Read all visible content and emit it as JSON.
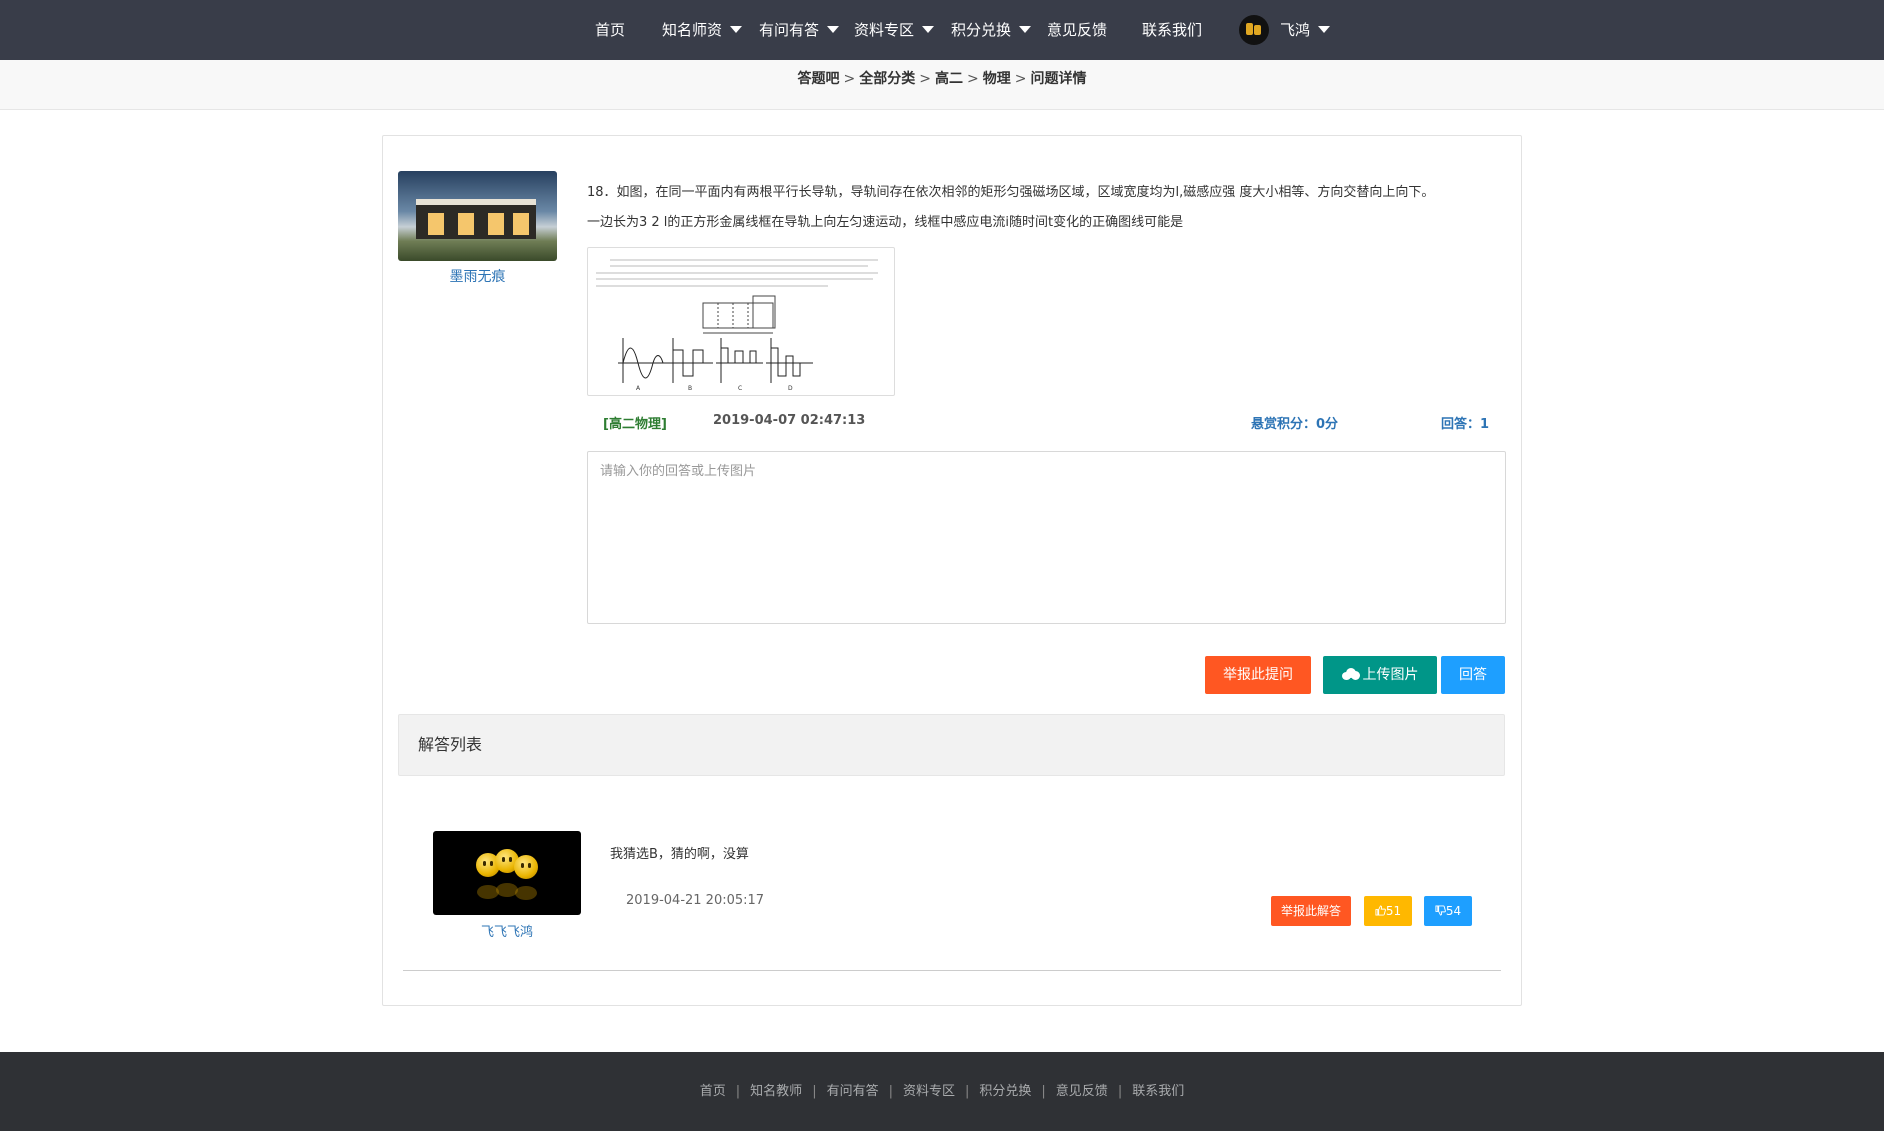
{
  "nav": {
    "items": [
      {
        "label": "首页",
        "dropdown": false
      },
      {
        "label": "知名师资",
        "dropdown": true
      },
      {
        "label": "有问有答",
        "dropdown": true
      },
      {
        "label": "资料专区",
        "dropdown": true
      },
      {
        "label": "积分兑换",
        "dropdown": true
      },
      {
        "label": "意见反馈",
        "dropdown": false
      },
      {
        "label": "联系我们",
        "dropdown": false
      }
    ],
    "user": {
      "name": "飞鸿",
      "icon": "user-avatar"
    }
  },
  "breadcrumb": {
    "items": [
      "答题吧",
      "全部分类",
      "高二",
      "物理",
      "问题详情"
    ],
    "separator": ">"
  },
  "question": {
    "asker_name": "墨雨无痕",
    "text_line1": "18．如图，在同一平面内有两根平行长导轨，导轨间存在依次相邻的矩形匀强磁场区域，区域宽度均为l,磁感应强 度大小相等、方向交替向上向下。",
    "text_line2": "一边长为3 2 l的正方形金属线框在导轨上向左匀速运动，线框中感应电流i随时间t变化的正确图线可能是",
    "category": "[高二物理]",
    "time": "2019-04-07 02:47:13",
    "reward": "悬赏积分：0分",
    "answer_count": "回答：1"
  },
  "reply": {
    "placeholder": "请输入你的回答或上传图片",
    "report_label": "举报此提问",
    "upload_label": "上传图片",
    "submit_label": "回答"
  },
  "answers": {
    "header": "解答列表",
    "items": [
      {
        "name": "飞飞飞鸿",
        "text": "我猜选B，猜的啊，没算",
        "time": "2019-04-21 20:05:17",
        "report_label": "举报此解答",
        "likes": "51",
        "dislikes": "54"
      }
    ]
  },
  "footer": {
    "links": [
      "首页",
      "知名教师",
      "有问有答",
      "资料专区",
      "积分兑换",
      "意见反馈",
      "联系我们"
    ],
    "separator": "|"
  },
  "colors": {
    "nav_bg": "#393d49",
    "accent_orange": "#ff5722",
    "accent_teal": "#009688",
    "accent_blue": "#1e9fff",
    "accent_yellow": "#ffb800",
    "link_blue": "#2d74b5",
    "category_green": "#2e7d32",
    "footer_bg": "#2f3135"
  }
}
